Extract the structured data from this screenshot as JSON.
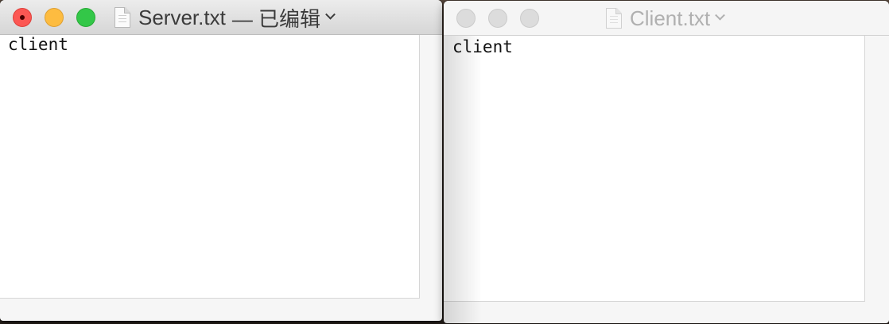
{
  "windows": {
    "server": {
      "title": "Server.txt",
      "edited_suffix": "— 已编辑",
      "content": "client"
    },
    "client": {
      "title": "Client.txt",
      "content": "client"
    }
  },
  "icons": {
    "close": "close-icon",
    "minimize": "minimize-icon",
    "zoom": "zoom-icon",
    "document": "document-icon",
    "chevron": "chevron-down-icon"
  },
  "colors": {
    "close": "#fc5753",
    "minimize": "#fdbc40",
    "zoom": "#33c748",
    "inactive_light": "#dcdcdc"
  }
}
